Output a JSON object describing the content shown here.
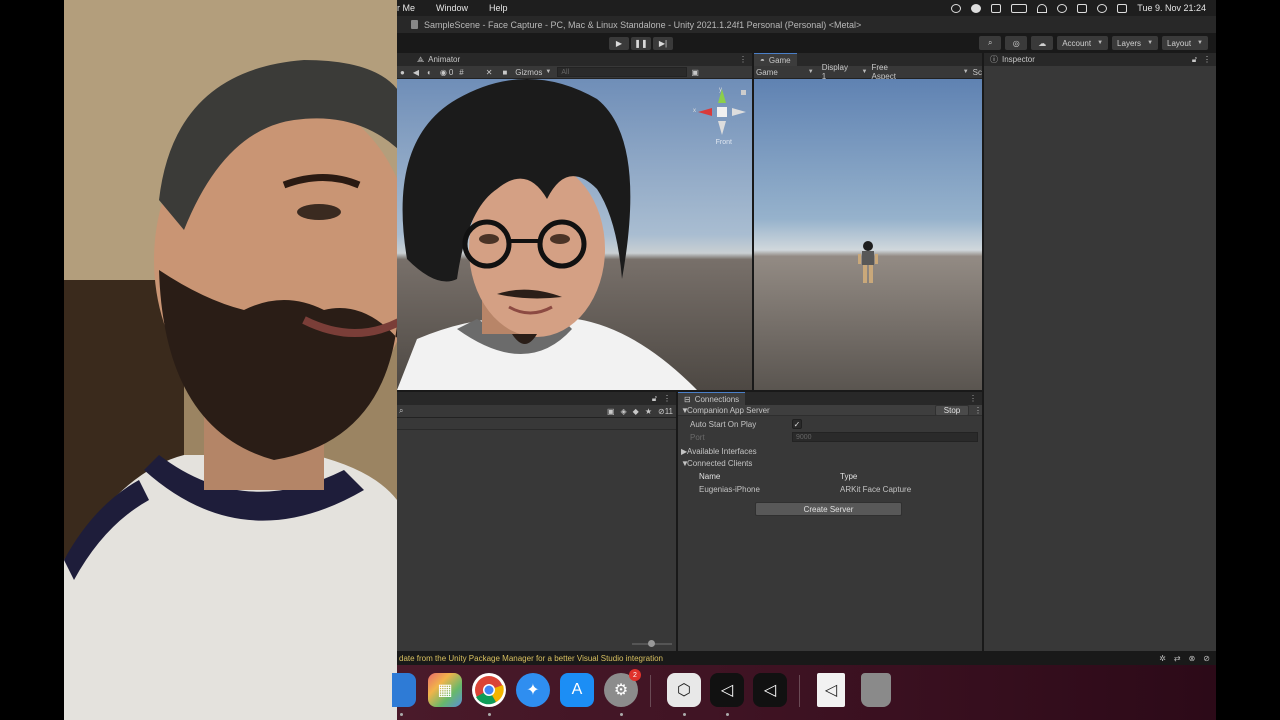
{
  "menubar": {
    "items": [
      "r Me",
      "Window",
      "Help"
    ],
    "clock": "Tue 9. Nov  21:24"
  },
  "title": "SampleScene - Face Capture - PC, Mac & Linux Standalone - Unity 2021.1.24f1 Personal (Personal) <Metal>",
  "toolbar": {
    "play_icon": "play-icon",
    "pause_icon": "pause-icon",
    "step_icon": "step-icon",
    "account": "Account",
    "layers": "Layers",
    "layout": "Layout"
  },
  "scene": {
    "tab": "Animator",
    "gizmos": "Gizmos",
    "search_placeholder": "All",
    "layer_count": "0",
    "orientation": "Front"
  },
  "game": {
    "tab": "Game",
    "mode": "Game",
    "display": "Display 1",
    "aspect": "Free Aspect",
    "scale": "Sc"
  },
  "inspector": {
    "tab": "Inspector"
  },
  "project": {
    "hidden_count": "11"
  },
  "connections": {
    "tab": "Connections",
    "section": "Companion App Server",
    "stop": "Stop",
    "auto_start_label": "Auto Start On Play",
    "auto_start_checked": "✓",
    "port_label": "Port",
    "port_value": "9000",
    "available_interfaces": "Available Interfaces",
    "connected_clients": "Connected Clients",
    "col_name": "Name",
    "col_type": "Type",
    "client_name": "Eugenias-iPhone",
    "client_type": "ARKit Face Capture",
    "create_server": "Create Server"
  },
  "status": {
    "message": "date from the Unity Package Manager for a better Visual Studio integration"
  },
  "dock": {
    "settings_badge": "2"
  },
  "colors": {
    "editor_bg": "#383838",
    "toolbar_bg": "#191919",
    "status_warning": "#d8c060"
  }
}
